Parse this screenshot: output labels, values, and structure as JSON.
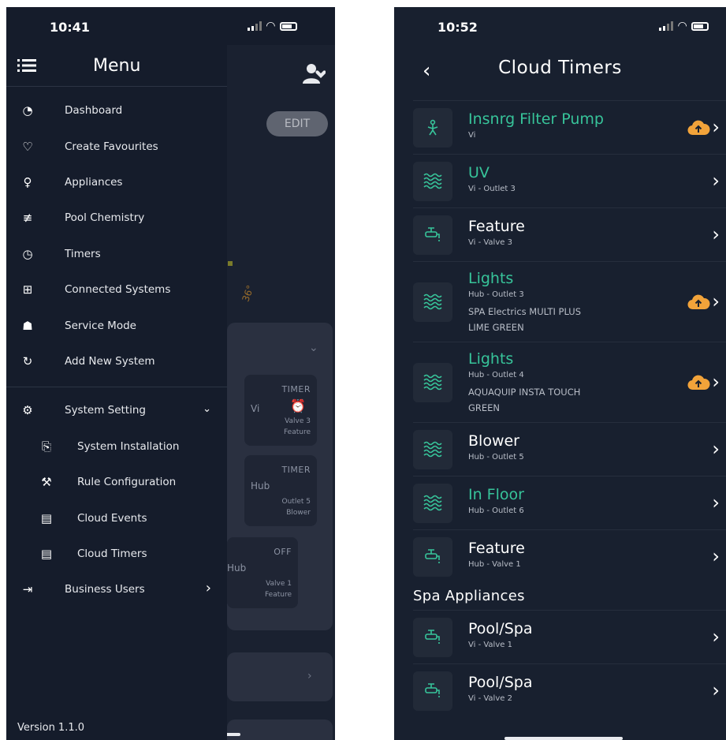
{
  "left": {
    "status": {
      "time": "10:41"
    },
    "menu": {
      "title": "Menu",
      "items": [
        {
          "label": "Dashboard",
          "icon": "gauge-icon"
        },
        {
          "label": "Create Favourites",
          "icon": "heart-icon"
        },
        {
          "label": "Appliances",
          "icon": "lightbulb-icon"
        },
        {
          "label": "Pool Chemistry",
          "icon": "sliders-icon"
        },
        {
          "label": "Timers",
          "icon": "clock-icon"
        },
        {
          "label": "Connected Systems",
          "icon": "grid-plus-icon"
        },
        {
          "label": "Service Mode",
          "icon": "network-icon"
        },
        {
          "label": "Add New System",
          "icon": "add-system-icon"
        }
      ],
      "system_setting": {
        "label": "System Setting",
        "icon": "gear-icon"
      },
      "sub_items": [
        {
          "label": "System Installation",
          "icon": "install-icon"
        },
        {
          "label": "Rule Configuration",
          "icon": "tools-icon"
        },
        {
          "label": "Cloud Events",
          "icon": "calendar-icon"
        },
        {
          "label": "Cloud Timers",
          "icon": "calendar-icon"
        }
      ],
      "business_users": {
        "label": "Business Users",
        "icon": "login-icon"
      },
      "version": "Version 1.1.0"
    },
    "dashboard": {
      "edit_label": "EDIT",
      "temp_mark": "36°",
      "tiles": [
        {
          "mode": "TIMER",
          "source": "Vi",
          "line1": "Valve 3",
          "line2": "Feature"
        },
        {
          "mode": "TIMER",
          "source": "Hub",
          "line1": "Outlet 5",
          "line2": "Blower"
        },
        {
          "mode": "OFF",
          "source": "Hub",
          "line1": "Valve 1",
          "line2": "Feature"
        }
      ]
    }
  },
  "right": {
    "status": {
      "time": "10:52"
    },
    "title": "Cloud Timers",
    "rows": [
      {
        "name": "Insnrg Filter Pump",
        "accent": true,
        "icon": "pump-icon",
        "sub": [
          "Vi"
        ],
        "cloud": true
      },
      {
        "name": "UV",
        "accent": true,
        "icon": "waves-icon",
        "sub": [
          "Vi - Outlet 3"
        ],
        "cloud": false
      },
      {
        "name": "Feature",
        "accent": false,
        "icon": "valve-icon",
        "sub": [
          "Vi - Valve 3"
        ],
        "cloud": false
      },
      {
        "name": "Lights",
        "accent": true,
        "icon": "waves-icon",
        "sub": [
          "Hub - Outlet 3",
          "SPA Electrics MULTI PLUS",
          "LIME GREEN"
        ],
        "cloud": true
      },
      {
        "name": "Lights",
        "accent": true,
        "icon": "waves-icon",
        "sub": [
          "Hub - Outlet 4",
          "AQUAQUIP INSTA TOUCH",
          "GREEN"
        ],
        "cloud": true
      },
      {
        "name": "Blower",
        "accent": false,
        "icon": "waves-icon",
        "sub": [
          "Hub - Outlet 5"
        ],
        "cloud": false
      },
      {
        "name": "In Floor",
        "accent": true,
        "icon": "waves-icon",
        "sub": [
          "Hub - Outlet 6"
        ],
        "cloud": false
      },
      {
        "name": "Feature",
        "accent": false,
        "icon": "valve-icon",
        "sub": [
          "Hub - Valve 1"
        ],
        "cloud": false
      }
    ],
    "section_label": "Spa Appliances",
    "spa_rows": [
      {
        "name": "Pool/Spa",
        "accent": false,
        "icon": "valve-icon",
        "sub": [
          "Vi - Valve 1"
        ],
        "cloud": false
      },
      {
        "name": "Pool/Spa",
        "accent": false,
        "icon": "valve-icon",
        "sub": [
          "Vi - Valve 2"
        ],
        "cloud": false
      }
    ]
  },
  "colors": {
    "accent": "#37c49a",
    "cloud": "#f2a33a",
    "background": "#151c2b"
  }
}
